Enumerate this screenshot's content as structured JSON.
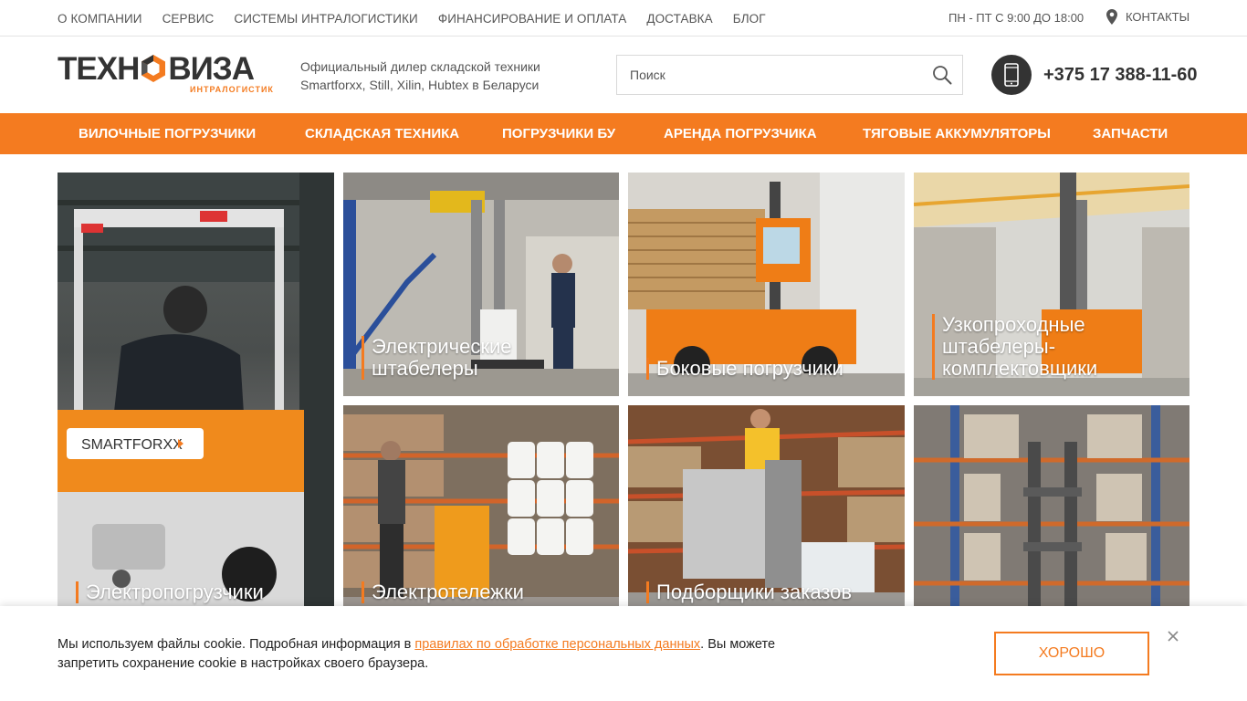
{
  "topnav": {
    "items": [
      "О КОМПАНИИ",
      "СЕРВИС",
      "СИСТЕМЫ ИНТРАЛОГИСТИКИ",
      "ФИНАНСИРОВАНИЕ И ОПЛАТА",
      "ДОСТАВКА",
      "БЛОГ"
    ],
    "hours": "ПН - ПТ С 9:00 ДО 18:00",
    "contacts": "КОНТАКТЫ"
  },
  "header": {
    "logo_left": "ТЕХН",
    "logo_right": "ВИЗА",
    "logo_sub": "ИНТРАЛОГИСТИК",
    "tagline_line1": "Официальный дилер складской техники",
    "tagline_line2": "Smartforxx, Still, Xilin, Hubtex в Беларуси",
    "search_placeholder": "Поиск",
    "phone": "+375 17 388-11-60"
  },
  "mainnav": [
    "ВИЛОЧНЫЕ ПОГРУЗЧИКИ",
    "СКЛАДСКАЯ ТЕХНИКА",
    "ПОГРУЗЧИКИ БУ",
    "АРЕНДА ПОГРУЗЧИКА",
    "ТЯГОВЫЕ АККУМУЛЯТОРЫ",
    "ЗАПЧАСТИ"
  ],
  "tiles": {
    "t1": "Электропогрузчики",
    "t2a": "Электрические",
    "t2b": "штабелеры",
    "t3": "Боковые погрузчики",
    "t4a": "Узкопроходные",
    "t4b": "штабелеры-",
    "t4c": "комплектовщики",
    "t5": "Электротележки",
    "t6": "Подборщики заказов",
    "brand_label": "SMARTFORXX"
  },
  "cookie": {
    "text_before": "Мы используем файлы cookie. Подробная информация в ",
    "link": "правилах по обработке персональных данных",
    "text_after": ". Вы можете запретить сохранение cookie в настройках своего браузера.",
    "ok": "ХОРОШО"
  },
  "colors": {
    "accent": "#f47b20",
    "dark": "#333333"
  }
}
